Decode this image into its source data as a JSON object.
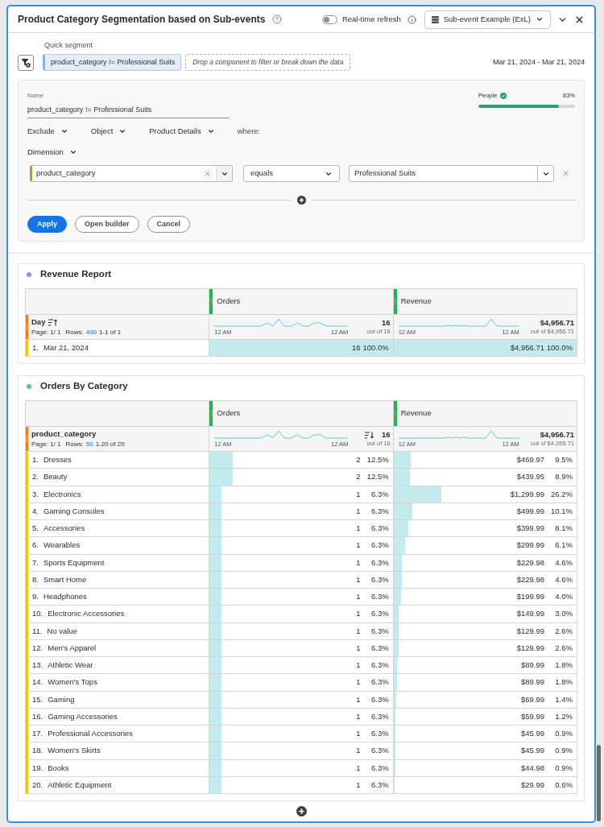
{
  "panel": {
    "title": "Product Category Segmentation based on Sub-events",
    "realtime_refresh": {
      "label": "Real-time refresh",
      "on": false
    },
    "data_view": "Sub-event Example (ExL)"
  },
  "quick_segment": {
    "label": "Quick segment",
    "chip": "product_category != Professional Suits",
    "drop_zone": "Drop a component to filter or break down the data",
    "date_range": "Mar 21, 2024 - Mar 21, 2024"
  },
  "segment_builder": {
    "name_label": "Name",
    "name": "product_category != Professional Suits",
    "people": {
      "label": "People",
      "reading": "83%",
      "level": 0.83
    },
    "scope": [
      {
        "label": "Exclude"
      },
      {
        "label": "Object"
      },
      {
        "label": "Product Details"
      }
    ],
    "where": "where:",
    "component_type": "Dimension",
    "condition": {
      "dimension": "product_category",
      "operator": "equals",
      "value": "Professional Suits"
    },
    "buttons": [
      {
        "label": "Apply",
        "kind": "primary"
      },
      {
        "label": "Open builder",
        "kind": "secondary"
      },
      {
        "label": "Cancel",
        "kind": "secondary"
      }
    ]
  },
  "reports": [
    {
      "title": "Revenue Report",
      "color": "#9b8cf2",
      "dimension": {
        "label": "Day",
        "sorted": true,
        "page": "Page: 1/ 1",
        "rows_label": "Rows:",
        "rows": "400",
        "range": "1-1 of 1"
      },
      "metrics": [
        {
          "label": "Orders",
          "sorted": false,
          "axis_labels": [
            "12 AM",
            "12 AM"
          ],
          "total": "16",
          "out_of": "out of 16"
        },
        {
          "label": "Revenue",
          "sorted": false,
          "axis_labels": [
            "12 AM",
            "12 AM"
          ],
          "total": "$4,956.71",
          "out_of": "out of $4,956.71"
        }
      ],
      "rows": [
        {
          "number": "1.",
          "label": "Mar 21, 2024",
          "cells": [
            {
              "value": "16",
              "percent": "100.0%",
              "level": 1
            },
            {
              "value": "$4,956.71",
              "percent": "100.0%",
              "level": 1
            }
          ]
        }
      ]
    },
    {
      "title": "Orders By Category",
      "color": "#4cd07d",
      "dimension": {
        "label": "product_category",
        "sorted": false,
        "page": "Page: 1/ 1",
        "rows_label": "Rows:",
        "rows": "50",
        "range": "1-20 of 20"
      },
      "metrics": [
        {
          "label": "Orders",
          "sorted": true,
          "axis_labels": [
            "12 AM",
            "12 AM"
          ],
          "total": "16",
          "out_of": "out of 16"
        },
        {
          "label": "Revenue",
          "sorted": false,
          "axis_labels": [
            "12 AM",
            "12 AM"
          ],
          "total": "$4,956.71",
          "out_of": "out of $4,956.71"
        }
      ],
      "rows": [
        {
          "number": "1.",
          "label": "Dresses",
          "cells": [
            {
              "value": "2",
              "percent": "12.5%",
              "level": 0.125
            },
            {
              "value": "$469.97",
              "percent": "9.5%",
              "level": 0.095
            }
          ]
        },
        {
          "number": "2.",
          "label": "Beauty",
          "cells": [
            {
              "value": "2",
              "percent": "12.5%",
              "level": 0.125
            },
            {
              "value": "$439.95",
              "percent": "8.9%",
              "level": 0.089
            }
          ]
        },
        {
          "number": "3.",
          "label": "Electronics",
          "cells": [
            {
              "value": "1",
              "percent": "6.3%",
              "level": 0.063
            },
            {
              "value": "$1,299.99",
              "percent": "26.2%",
              "level": 0.262
            }
          ]
        },
        {
          "number": "4.",
          "label": "Gaming Consoles",
          "cells": [
            {
              "value": "1",
              "percent": "6.3%",
              "level": 0.063
            },
            {
              "value": "$499.99",
              "percent": "10.1%",
              "level": 0.101
            }
          ]
        },
        {
          "number": "5.",
          "label": "Accessories",
          "cells": [
            {
              "value": "1",
              "percent": "6.3%",
              "level": 0.063
            },
            {
              "value": "$399.99",
              "percent": "8.1%",
              "level": 0.081
            }
          ]
        },
        {
          "number": "6.",
          "label": "Wearables",
          "cells": [
            {
              "value": "1",
              "percent": "6.3%",
              "level": 0.063
            },
            {
              "value": "$299.99",
              "percent": "6.1%",
              "level": 0.061
            }
          ]
        },
        {
          "number": "7.",
          "label": "Sports Equipment",
          "cells": [
            {
              "value": "1",
              "percent": "6.3%",
              "level": 0.063
            },
            {
              "value": "$229.98",
              "percent": "4.6%",
              "level": 0.046
            }
          ]
        },
        {
          "number": "8.",
          "label": "Smart Home",
          "cells": [
            {
              "value": "1",
              "percent": "6.3%",
              "level": 0.063
            },
            {
              "value": "$229.98",
              "percent": "4.6%",
              "level": 0.046
            }
          ]
        },
        {
          "number": "9.",
          "label": "Headphones",
          "cells": [
            {
              "value": "1",
              "percent": "6.3%",
              "level": 0.063
            },
            {
              "value": "$199.99",
              "percent": "4.0%",
              "level": 0.04
            }
          ]
        },
        {
          "number": "10.",
          "label": "Electronic Accessories",
          "cells": [
            {
              "value": "1",
              "percent": "6.3%",
              "level": 0.063
            },
            {
              "value": "$149.99",
              "percent": "3.0%",
              "level": 0.03
            }
          ]
        },
        {
          "number": "11.",
          "label": "No value",
          "cells": [
            {
              "value": "1",
              "percent": "6.3%",
              "level": 0.063
            },
            {
              "value": "$129.99",
              "percent": "2.6%",
              "level": 0.026
            }
          ]
        },
        {
          "number": "12.",
          "label": "Men's Apparel",
          "cells": [
            {
              "value": "1",
              "percent": "6.3%",
              "level": 0.063
            },
            {
              "value": "$129.99",
              "percent": "2.6%",
              "level": 0.026
            }
          ]
        },
        {
          "number": "13.",
          "label": "Athletic Wear",
          "cells": [
            {
              "value": "1",
              "percent": "6.3%",
              "level": 0.063
            },
            {
              "value": "$89.99",
              "percent": "1.8%",
              "level": 0.018
            }
          ]
        },
        {
          "number": "14.",
          "label": "Women's Tops",
          "cells": [
            {
              "value": "1",
              "percent": "6.3%",
              "level": 0.063
            },
            {
              "value": "$89.99",
              "percent": "1.8%",
              "level": 0.018
            }
          ]
        },
        {
          "number": "15.",
          "label": "Gaming",
          "cells": [
            {
              "value": "1",
              "percent": "6.3%",
              "level": 0.063
            },
            {
              "value": "$69.99",
              "percent": "1.4%",
              "level": 0.014
            }
          ]
        },
        {
          "number": "16.",
          "label": "Gaming Accessories",
          "cells": [
            {
              "value": "1",
              "percent": "6.3%",
              "level": 0.063
            },
            {
              "value": "$59.99",
              "percent": "1.2%",
              "level": 0.012
            }
          ]
        },
        {
          "number": "17.",
          "label": "Professional Accessories",
          "cells": [
            {
              "value": "1",
              "percent": "6.3%",
              "level": 0.063
            },
            {
              "value": "$45.99",
              "percent": "0.9%",
              "level": 0.009
            }
          ]
        },
        {
          "number": "18.",
          "label": "Women's Skirts",
          "cells": [
            {
              "value": "1",
              "percent": "6.3%",
              "level": 0.063
            },
            {
              "value": "$45.99",
              "percent": "0.9%",
              "level": 0.009
            }
          ]
        },
        {
          "number": "19.",
          "label": "Books",
          "cells": [
            {
              "value": "1",
              "percent": "6.3%",
              "level": 0.063
            },
            {
              "value": "$44.98",
              "percent": "0.9%",
              "level": 0.009
            }
          ]
        },
        {
          "number": "20.",
          "label": "Athletic Equipment",
          "cells": [
            {
              "value": "1",
              "percent": "6.3%",
              "level": 0.063
            },
            {
              "value": "$29.99",
              "percent": "0.6%",
              "level": 0.006
            }
          ]
        }
      ]
    }
  ]
}
